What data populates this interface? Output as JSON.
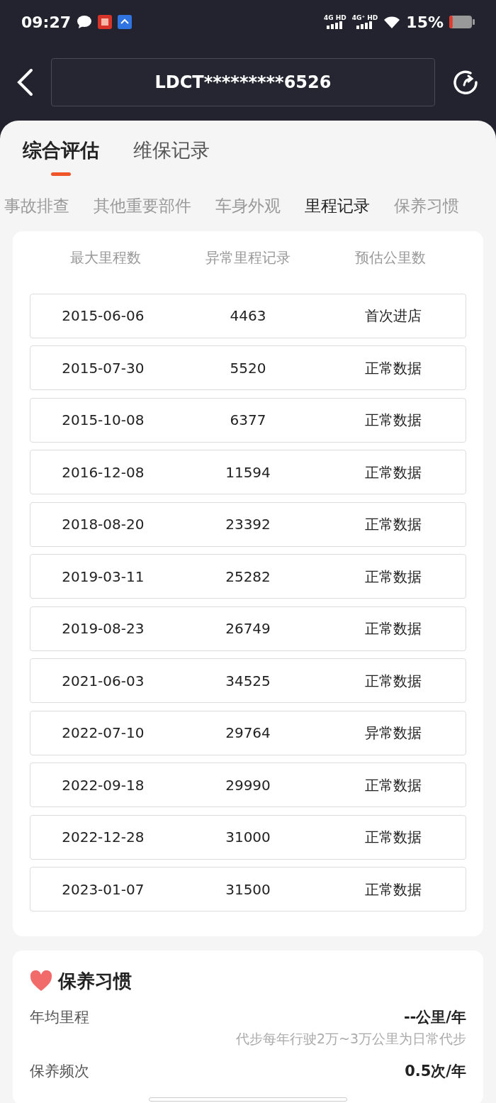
{
  "status_bar": {
    "time": "09:27",
    "network_1": "4G HD",
    "network_2": "4G⁺ HD",
    "battery": "15%"
  },
  "header": {
    "title": "LDCT*********6526"
  },
  "main_tabs": [
    {
      "label": "综合评估",
      "selected": true
    },
    {
      "label": "维保记录",
      "selected": false
    }
  ],
  "section_tabs": [
    {
      "label": "事故排查",
      "selected": false
    },
    {
      "label": "其他重要部件",
      "selected": false
    },
    {
      "label": "车身外观",
      "selected": false
    },
    {
      "label": "里程记录",
      "selected": true
    },
    {
      "label": "保养习惯",
      "selected": false
    }
  ],
  "summary": [
    {
      "label": "最大里程数"
    },
    {
      "label": "异常里程记录"
    },
    {
      "label": "预估公里数"
    }
  ],
  "records": [
    {
      "date": "2015-06-06",
      "mileage": "4463",
      "status": "首次进店"
    },
    {
      "date": "2015-07-30",
      "mileage": "5520",
      "status": "正常数据"
    },
    {
      "date": "2015-10-08",
      "mileage": "6377",
      "status": "正常数据"
    },
    {
      "date": "2016-12-08",
      "mileage": "11594",
      "status": "正常数据"
    },
    {
      "date": "2018-08-20",
      "mileage": "23392",
      "status": "正常数据"
    },
    {
      "date": "2019-03-11",
      "mileage": "25282",
      "status": "正常数据"
    },
    {
      "date": "2019-08-23",
      "mileage": "26749",
      "status": "正常数据"
    },
    {
      "date": "2021-06-03",
      "mileage": "34525",
      "status": "正常数据"
    },
    {
      "date": "2022-07-10",
      "mileage": "29764",
      "status": "异常数据"
    },
    {
      "date": "2022-09-18",
      "mileage": "29990",
      "status": "正常数据"
    },
    {
      "date": "2022-12-28",
      "mileage": "31000",
      "status": "正常数据"
    },
    {
      "date": "2023-01-07",
      "mileage": "31500",
      "status": "正常数据"
    }
  ],
  "habits": {
    "title": "保养习惯",
    "items": [
      {
        "label": "年均里程",
        "value": "--公里/年",
        "note": "代步每年行驶2万~3万公里为日常代步"
      },
      {
        "label": "保养频次",
        "value": "0.5次/年"
      }
    ]
  }
}
